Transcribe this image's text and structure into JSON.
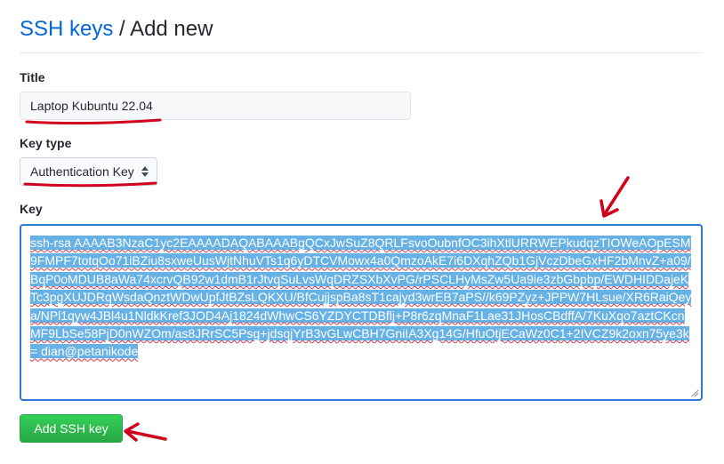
{
  "breadcrumb": {
    "parent": "SSH keys",
    "separator": "/",
    "current": "Add new"
  },
  "form": {
    "title_label": "Title",
    "title_value": "Laptop Kubuntu 22.04",
    "key_type_label": "Key type",
    "key_type_value": "Authentication Key",
    "key_label": "Key",
    "key_value": "ssh-rsa AAAAB3NzaC1yc2EAAAADAQABAAABgQCxJwSuZ8QRLFsvoOubnfOC3ihXtlURRWEPkudqzTIOWeAOpESM9FMPF7totqOo71iBZiu8sxweUusWjtNhuVTs1q6yDTCVMowx4a0QmzoAkE7i6DXqhZQb1GjVczDbeGxHF2bMnvZ+a09/BqP0oMDUB8aWa74xcrvQB92w1dmB1rJtvqSuLvsWqDRZSXbXvPG/rPSCLHyMsZw5Ua9ie3zbGbpbp/EWDHIDDajeKTc3pgXUJDRqWsdaQnztWDwUpfJtBZsLQKXU/BfCujjspBa8sT1cajyd3wrEB7aPS//k69PZyz+JPPW7HLsue/XR6RaiQeya/NPl1qyw4JBl4u1NldkKref3JOD4Aj1824dWhwCS6YZDYCTDBflj+P8r6zqMnaF1Lae31JHosCBdffA/7KuXqo7aztCKcnMF9LbSe58PjD0nWZOm/as8JRrSC5Psg+jdsqjYrB3vGLwCBH7GniIA3Xg14G/HfuOtjECaWz0C1+2IVCZ9k2oxn75ye3k= dian@petanikode",
    "submit_label": "Add SSH key"
  },
  "colors": {
    "link": "#0366d6",
    "selection": "#66b2e6",
    "focus_border": "#2b7bd6",
    "button": "#2ea44f",
    "annotation": "#d0021b"
  },
  "icons": {
    "select_arrows": "up-down-arrows-icon",
    "resize": "resize-grip-icon"
  }
}
